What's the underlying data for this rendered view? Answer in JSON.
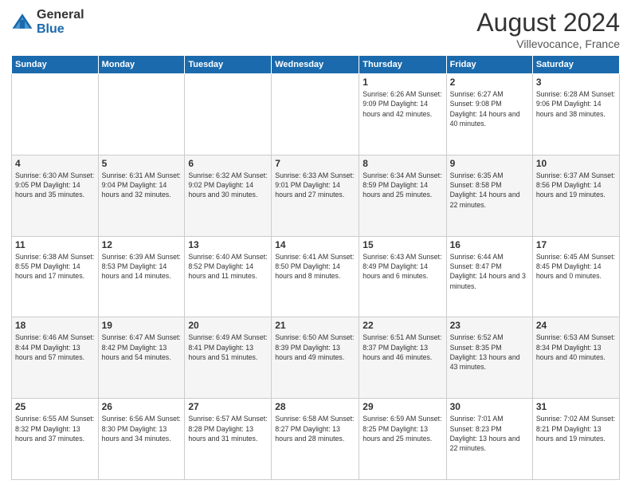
{
  "header": {
    "logo_general": "General",
    "logo_blue": "Blue",
    "month_title": "August 2024",
    "location": "Villevocance, France"
  },
  "weekdays": [
    "Sunday",
    "Monday",
    "Tuesday",
    "Wednesday",
    "Thursday",
    "Friday",
    "Saturday"
  ],
  "weeks": [
    [
      {
        "day": "",
        "info": ""
      },
      {
        "day": "",
        "info": ""
      },
      {
        "day": "",
        "info": ""
      },
      {
        "day": "",
        "info": ""
      },
      {
        "day": "1",
        "info": "Sunrise: 6:26 AM\nSunset: 9:09 PM\nDaylight: 14 hours\nand 42 minutes."
      },
      {
        "day": "2",
        "info": "Sunrise: 6:27 AM\nSunset: 9:08 PM\nDaylight: 14 hours\nand 40 minutes."
      },
      {
        "day": "3",
        "info": "Sunrise: 6:28 AM\nSunset: 9:06 PM\nDaylight: 14 hours\nand 38 minutes."
      }
    ],
    [
      {
        "day": "4",
        "info": "Sunrise: 6:30 AM\nSunset: 9:05 PM\nDaylight: 14 hours\nand 35 minutes."
      },
      {
        "day": "5",
        "info": "Sunrise: 6:31 AM\nSunset: 9:04 PM\nDaylight: 14 hours\nand 32 minutes."
      },
      {
        "day": "6",
        "info": "Sunrise: 6:32 AM\nSunset: 9:02 PM\nDaylight: 14 hours\nand 30 minutes."
      },
      {
        "day": "7",
        "info": "Sunrise: 6:33 AM\nSunset: 9:01 PM\nDaylight: 14 hours\nand 27 minutes."
      },
      {
        "day": "8",
        "info": "Sunrise: 6:34 AM\nSunset: 8:59 PM\nDaylight: 14 hours\nand 25 minutes."
      },
      {
        "day": "9",
        "info": "Sunrise: 6:35 AM\nSunset: 8:58 PM\nDaylight: 14 hours\nand 22 minutes."
      },
      {
        "day": "10",
        "info": "Sunrise: 6:37 AM\nSunset: 8:56 PM\nDaylight: 14 hours\nand 19 minutes."
      }
    ],
    [
      {
        "day": "11",
        "info": "Sunrise: 6:38 AM\nSunset: 8:55 PM\nDaylight: 14 hours\nand 17 minutes."
      },
      {
        "day": "12",
        "info": "Sunrise: 6:39 AM\nSunset: 8:53 PM\nDaylight: 14 hours\nand 14 minutes."
      },
      {
        "day": "13",
        "info": "Sunrise: 6:40 AM\nSunset: 8:52 PM\nDaylight: 14 hours\nand 11 minutes."
      },
      {
        "day": "14",
        "info": "Sunrise: 6:41 AM\nSunset: 8:50 PM\nDaylight: 14 hours\nand 8 minutes."
      },
      {
        "day": "15",
        "info": "Sunrise: 6:43 AM\nSunset: 8:49 PM\nDaylight: 14 hours\nand 6 minutes."
      },
      {
        "day": "16",
        "info": "Sunrise: 6:44 AM\nSunset: 8:47 PM\nDaylight: 14 hours\nand 3 minutes."
      },
      {
        "day": "17",
        "info": "Sunrise: 6:45 AM\nSunset: 8:45 PM\nDaylight: 14 hours\nand 0 minutes."
      }
    ],
    [
      {
        "day": "18",
        "info": "Sunrise: 6:46 AM\nSunset: 8:44 PM\nDaylight: 13 hours\nand 57 minutes."
      },
      {
        "day": "19",
        "info": "Sunrise: 6:47 AM\nSunset: 8:42 PM\nDaylight: 13 hours\nand 54 minutes."
      },
      {
        "day": "20",
        "info": "Sunrise: 6:49 AM\nSunset: 8:41 PM\nDaylight: 13 hours\nand 51 minutes."
      },
      {
        "day": "21",
        "info": "Sunrise: 6:50 AM\nSunset: 8:39 PM\nDaylight: 13 hours\nand 49 minutes."
      },
      {
        "day": "22",
        "info": "Sunrise: 6:51 AM\nSunset: 8:37 PM\nDaylight: 13 hours\nand 46 minutes."
      },
      {
        "day": "23",
        "info": "Sunrise: 6:52 AM\nSunset: 8:35 PM\nDaylight: 13 hours\nand 43 minutes."
      },
      {
        "day": "24",
        "info": "Sunrise: 6:53 AM\nSunset: 8:34 PM\nDaylight: 13 hours\nand 40 minutes."
      }
    ],
    [
      {
        "day": "25",
        "info": "Sunrise: 6:55 AM\nSunset: 8:32 PM\nDaylight: 13 hours\nand 37 minutes."
      },
      {
        "day": "26",
        "info": "Sunrise: 6:56 AM\nSunset: 8:30 PM\nDaylight: 13 hours\nand 34 minutes."
      },
      {
        "day": "27",
        "info": "Sunrise: 6:57 AM\nSunset: 8:28 PM\nDaylight: 13 hours\nand 31 minutes."
      },
      {
        "day": "28",
        "info": "Sunrise: 6:58 AM\nSunset: 8:27 PM\nDaylight: 13 hours\nand 28 minutes."
      },
      {
        "day": "29",
        "info": "Sunrise: 6:59 AM\nSunset: 8:25 PM\nDaylight: 13 hours\nand 25 minutes."
      },
      {
        "day": "30",
        "info": "Sunrise: 7:01 AM\nSunset: 8:23 PM\nDaylight: 13 hours\nand 22 minutes."
      },
      {
        "day": "31",
        "info": "Sunrise: 7:02 AM\nSunset: 8:21 PM\nDaylight: 13 hours\nand 19 minutes."
      }
    ]
  ]
}
